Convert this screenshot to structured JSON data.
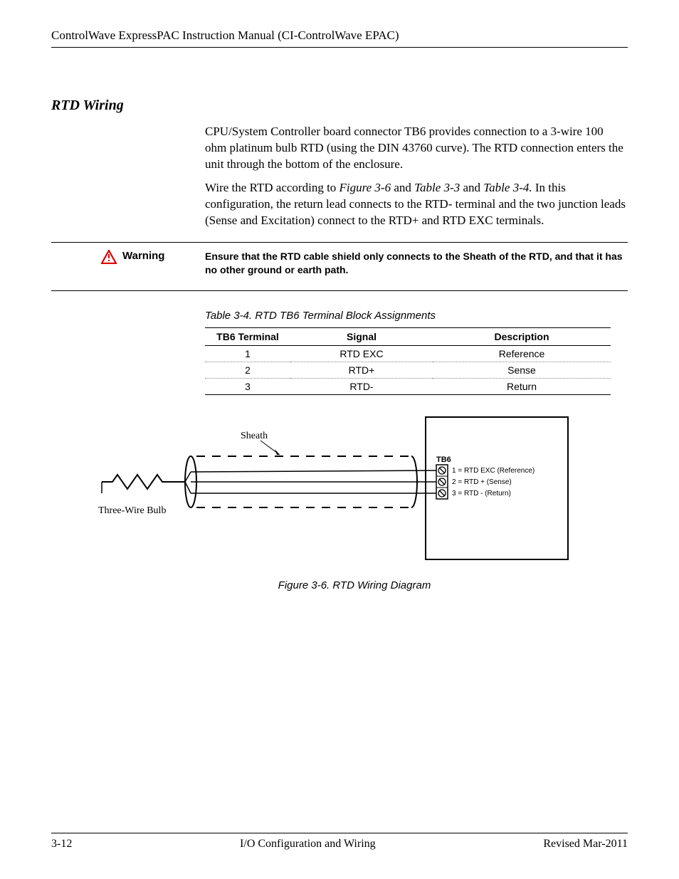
{
  "header": {
    "title": "ControlWave ExpressPAC Instruction Manual (CI-ControlWave EPAC)"
  },
  "section": {
    "heading": "RTD Wiring",
    "para1": "CPU/System Controller board connector TB6 provides connection to a 3-wire 100 ohm platinum bulb RTD (using the DIN 43760 curve). The RTD connection enters the unit through the bottom of the enclosure.",
    "para2_pre": "Wire the RTD according to ",
    "para2_ref1": "Figure 3-6",
    "para2_mid1": " and ",
    "para2_ref2": "Table 3-3",
    "para2_mid2": " and ",
    "para2_ref3": "Table 3-4.",
    "para2_post": " In this configuration, the return lead connects to the RTD- terminal and the two junction leads (Sense and Excitation) connect to the RTD+ and RTD EXC terminals."
  },
  "warning": {
    "label": "Warning",
    "text": "Ensure that the RTD cable shield only connects to the Sheath of the RTD, and that it has no other ground or earth path."
  },
  "table": {
    "caption": "Table 3-4. RTD TB6 Terminal Block Assignments",
    "headers": [
      "TB6 Terminal",
      "Signal",
      "Description"
    ],
    "rows": [
      {
        "t": "1",
        "s": "RTD EXC",
        "d": "Reference"
      },
      {
        "t": "2",
        "s": "RTD+",
        "d": "Sense"
      },
      {
        "t": "3",
        "s": "RTD-",
        "d": "Return"
      }
    ]
  },
  "figure": {
    "labels": {
      "sheath": "Sheath",
      "bulb": "Three-Wire Bulb",
      "tb6": "TB6",
      "l1": "1 = RTD EXC (Reference)",
      "l2": "2 = RTD + (Sense)",
      "l3": "3 = RTD - (Return)"
    },
    "caption": "Figure 3-6. RTD Wiring Diagram"
  },
  "footer": {
    "left": "3-12",
    "center": "I/O Configuration and Wiring",
    "right": "Revised Mar-2011"
  }
}
